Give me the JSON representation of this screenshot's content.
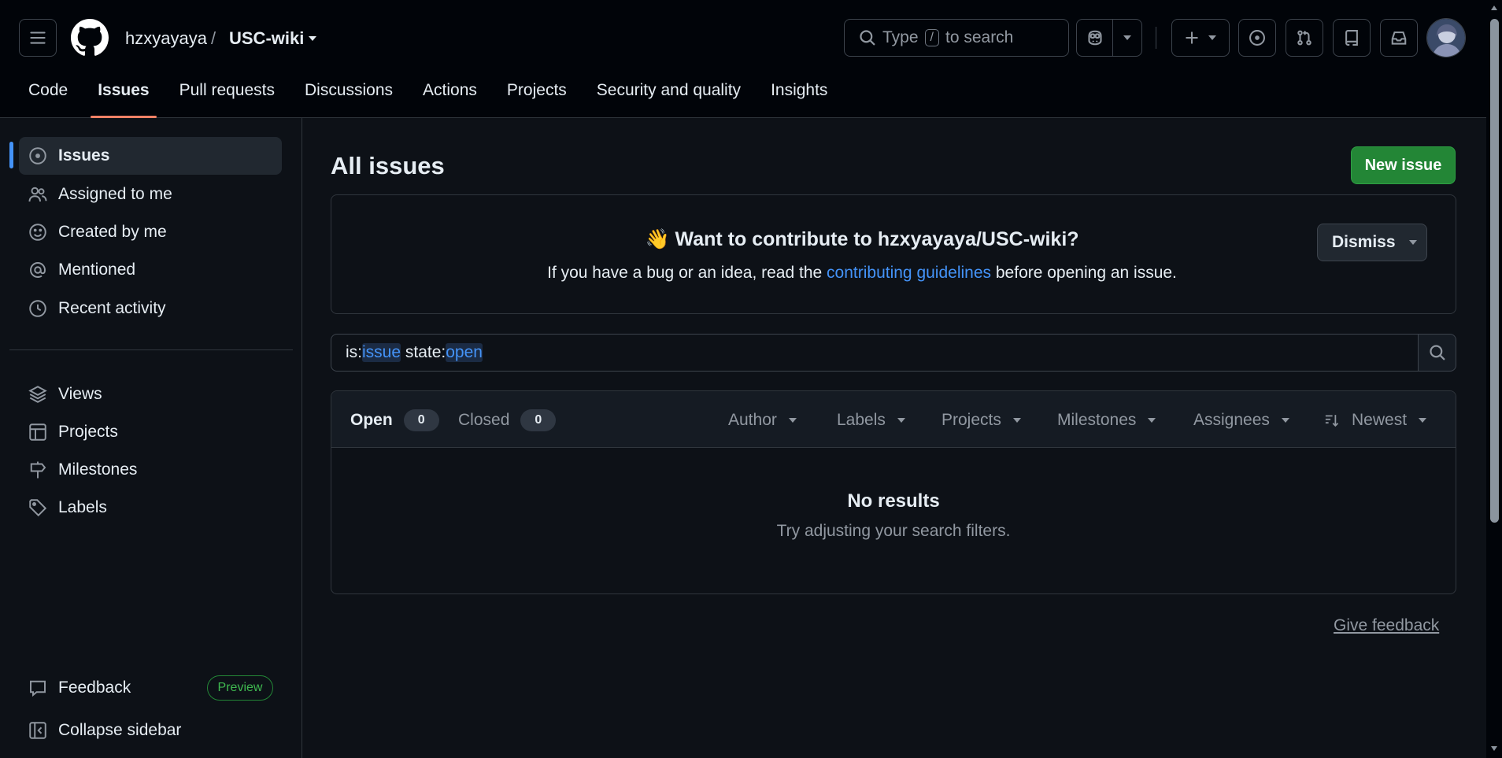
{
  "header": {
    "owner": "hzxyayaya",
    "separator": "/",
    "repo": "USC-wiki",
    "search": {
      "prefix": "Type",
      "key": "/",
      "suffix": "to search"
    }
  },
  "repo_tabs": [
    {
      "label": "Code"
    },
    {
      "label": "Issues"
    },
    {
      "label": "Pull requests"
    },
    {
      "label": "Discussions"
    },
    {
      "label": "Actions"
    },
    {
      "label": "Projects"
    },
    {
      "label": "Security and quality"
    },
    {
      "label": "Insights"
    }
  ],
  "sidebar": {
    "items": [
      {
        "label": "Issues",
        "icon": "issue-opened-icon"
      },
      {
        "label": "Assigned to me",
        "icon": "people-icon"
      },
      {
        "label": "Created by me",
        "icon": "smiley-icon"
      },
      {
        "label": "Mentioned",
        "icon": "mention-icon"
      },
      {
        "label": "Recent activity",
        "icon": "clock-icon"
      }
    ],
    "secondary": [
      {
        "label": "Views",
        "icon": "stack-icon"
      },
      {
        "label": "Projects",
        "icon": "table-icon"
      },
      {
        "label": "Milestones",
        "icon": "milestone-icon"
      },
      {
        "label": "Labels",
        "icon": "tag-icon"
      }
    ],
    "feedback_label": "Feedback",
    "preview_badge": "Preview",
    "collapse_label": "Collapse sidebar"
  },
  "main": {
    "title": "All issues",
    "new_issue_label": "New issue",
    "banner": {
      "emoji": "👋",
      "title": "Want to contribute to hzxyayaya/USC-wiki?",
      "text_before": "If you have a bug or an idea, read the",
      "link": "contributing guidelines",
      "text_after": "before opening an issue.",
      "dismiss_label": "Dismiss"
    },
    "query": {
      "q1_key": "is:",
      "q1_val": "issue",
      "q2_key": "state:",
      "q2_val": "open"
    },
    "states": {
      "open_label": "Open",
      "open_count": "0",
      "closed_label": "Closed",
      "closed_count": "0"
    },
    "filters": [
      "Author",
      "Labels",
      "Projects",
      "Milestones",
      "Assignees"
    ],
    "sort_label": "Newest",
    "empty_title": "No results",
    "empty_text": "Try adjusting your search filters.",
    "give_feedback": "Give feedback"
  },
  "colors": {
    "accent": "#4493f8",
    "primary_button": "#238636",
    "tab_underline": "#f78166"
  }
}
